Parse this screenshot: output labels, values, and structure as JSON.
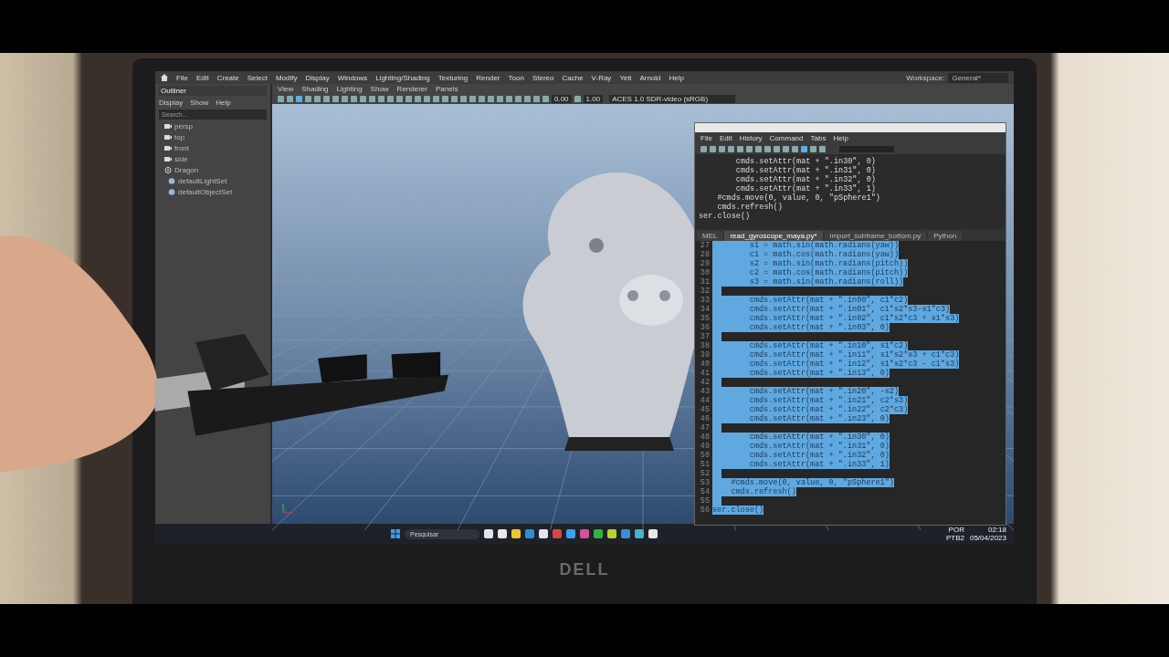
{
  "menu_bar": {
    "items": [
      "File",
      "Edit",
      "Create",
      "Select",
      "Modify",
      "Display",
      "Windows",
      "Lighting/Shading",
      "Texturing",
      "Render",
      "Toon",
      "Stereo",
      "Cache",
      "V-Ray",
      "Yeti",
      "Arnold",
      "Help"
    ]
  },
  "workspace": {
    "label": "Workspace:",
    "value": "General*"
  },
  "outliner": {
    "title": "Outliner",
    "menu": [
      "Display",
      "Show",
      "Help"
    ],
    "search": {
      "placeholder": "Search..."
    },
    "items": [
      {
        "label": "persp",
        "kind": "camera"
      },
      {
        "label": "top",
        "kind": "camera"
      },
      {
        "label": "front",
        "kind": "camera"
      },
      {
        "label": "side",
        "kind": "camera"
      },
      {
        "label": "Dragon",
        "kind": "mesh"
      },
      {
        "label": "defaultLightSet",
        "kind": "set"
      },
      {
        "label": "defaultObjectSet",
        "kind": "set"
      }
    ]
  },
  "viewport": {
    "menu": [
      "View",
      "Shading",
      "Lighting",
      "Show",
      "Renderer",
      "Panels"
    ],
    "fields": [
      "0.00",
      "1.00"
    ],
    "color_space": "ACES 1.0 SDR-video (sRGB)"
  },
  "script_editor": {
    "menu": [
      "File",
      "Edit",
      "History",
      "Command",
      "Tabs",
      "Help"
    ],
    "output_lines": [
      "        cmds.setAttr(mat + \".in30\", 0)",
      "        cmds.setAttr(mat + \".in31\", 0)",
      "        cmds.setAttr(mat + \".in32\", 0)",
      "        cmds.setAttr(mat + \".in33\", 1)",
      "    #cmds.move(0, value, 0, \"pSphere1\")",
      "    cmds.refresh()",
      "ser.close()"
    ],
    "tabs": [
      {
        "label": "MEL",
        "selected": false
      },
      {
        "label": "read_gyroscope_maya.py*",
        "selected": true
      },
      {
        "label": "import_subframe_bottom.py",
        "selected": false
      },
      {
        "label": "Python",
        "selected": false
      }
    ],
    "code_lines": [
      {
        "number": "27",
        "text": "        s1 = math.sin(math.radians(yaw))",
        "selected": true
      },
      {
        "number": "28",
        "text": "        c1 = math.cos(math.radians(yaw))",
        "selected": true
      },
      {
        "number": "29",
        "text": "        s2 = math.sin(math.radians(pitch))",
        "selected": true
      },
      {
        "number": "30",
        "text": "        c2 = math.cos(math.radians(pitch))",
        "selected": true
      },
      {
        "number": "31",
        "text": "        s3 = math.sin(math.radians(roll))",
        "selected": true
      },
      {
        "number": "32",
        "selected": true
      },
      {
        "number": "33",
        "text": "        cmds.setAttr(mat + \".in00\", c1*c2)",
        "selected": true
      },
      {
        "number": "34",
        "text": "        cmds.setAttr(mat + \".in01\", c1*s2*s3-s1*c3)",
        "selected": true
      },
      {
        "number": "35",
        "text": "        cmds.setAttr(mat + \".in02\", c1*s2*c3 + s1*s3)",
        "selected": true
      },
      {
        "number": "36",
        "text": "        cmds.setAttr(mat + \".in03\", 0)",
        "selected": true
      },
      {
        "number": "37",
        "selected": true
      },
      {
        "number": "38",
        "text": "        cmds.setAttr(mat + \".in10\", s1*c2)",
        "selected": true
      },
      {
        "number": "39",
        "text": "        cmds.setAttr(mat + \".in11\", s1*s2*s3 + c1*c3)",
        "selected": true
      },
      {
        "number": "40",
        "text": "        cmds.setAttr(mat + \".in12\", s1*s2*c3 - c1*s3)",
        "selected": true
      },
      {
        "number": "41",
        "text": "        cmds.setAttr(mat + \".in13\", 0)",
        "selected": true
      },
      {
        "number": "42",
        "selected": true
      },
      {
        "number": "43",
        "text": "        cmds.setAttr(mat + \".in20\", -s2)",
        "selected": true
      },
      {
        "number": "44",
        "text": "        cmds.setAttr(mat + \".in21\", c2*s3)",
        "selected": true
      },
      {
        "number": "45",
        "text": "        cmds.setAttr(mat + \".in22\", c2*c3)",
        "selected": true
      },
      {
        "number": "46",
        "text": "        cmds.setAttr(mat + \".in23\", 0)",
        "selected": true
      },
      {
        "number": "47",
        "selected": true
      },
      {
        "number": "48",
        "text": "        cmds.setAttr(mat + \".in30\", 0)",
        "selected": true
      },
      {
        "number": "49",
        "text": "        cmds.setAttr(mat + \".in31\", 0)",
        "selected": true
      },
      {
        "number": "50",
        "text": "        cmds.setAttr(mat + \".in32\", 0)",
        "selected": true
      },
      {
        "number": "51",
        "text": "        cmds.setAttr(mat + \".in33\", 1)",
        "selected": true
      },
      {
        "number": "52",
        "selected": true
      },
      {
        "number": "53",
        "text": "    #cmds.move(0, value, 0, \"pSphere1\")",
        "selected": true
      },
      {
        "number": "54",
        "text": "    cmds.refresh()",
        "selected": true
      },
      {
        "number": "55",
        "selected": true
      },
      {
        "number": "56",
        "text": "ser.close()",
        "selected": true
      }
    ]
  },
  "taskbar": {
    "search": {
      "placeholder": "Pesquisar"
    },
    "language": "POR",
    "keyboard": "PTB2",
    "time": "02:18",
    "date": "05/04/2023"
  },
  "bezel": {
    "logo": "DELL"
  }
}
